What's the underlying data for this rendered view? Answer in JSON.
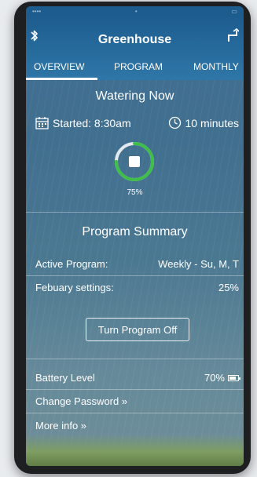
{
  "header": {
    "title": "Greenhouse",
    "tabs": [
      {
        "label": "OVERVIEW",
        "active": true
      },
      {
        "label": "PROGRAM",
        "active": false
      },
      {
        "label": "MONTHLY",
        "active": false
      }
    ]
  },
  "watering": {
    "title": "Watering Now",
    "started": "Started: 8:30am",
    "duration": "10 minutes",
    "progress_percent": 75,
    "progress_label": "75%"
  },
  "summary": {
    "title": "Program Summary",
    "active_program_label": "Active Program:",
    "active_program_value": "Weekly - Su, M, T",
    "february_label": "Febuary settings:",
    "february_value": "25%",
    "turn_off_label": "Turn Program Off"
  },
  "footer": {
    "battery_label": "Battery  Level",
    "battery_value": "70%",
    "battery_fraction": 0.7,
    "change_password": "Change Password »",
    "more_info": "More info »"
  },
  "colors": {
    "accent_green": "#3fbf4a",
    "header_blue": "#1d5c8f"
  }
}
